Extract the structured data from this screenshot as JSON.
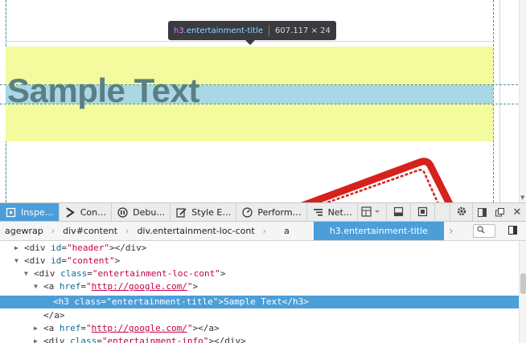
{
  "page": {
    "sample_text": "Sample Text"
  },
  "tooltip": {
    "tag": "h3",
    "class_name": ".entertainment-title",
    "dimensions": "607.117 × 24"
  },
  "toolbar": {
    "tabs": [
      {
        "label": "Inspe…",
        "icon": "inspector-icon",
        "active": true
      },
      {
        "label": "Con…",
        "icon": "console-icon",
        "active": false
      },
      {
        "label": "Debu…",
        "icon": "debugger-icon",
        "active": false
      },
      {
        "label": "Style E…",
        "icon": "style-editor-icon",
        "active": false
      },
      {
        "label": "Perform…",
        "icon": "performance-icon",
        "active": false
      },
      {
        "label": "Net…",
        "icon": "network-icon",
        "active": false
      }
    ]
  },
  "breadcrumbs": {
    "items": [
      "agewrap",
      "div#content",
      "div.entertainment-loc-cont",
      "a",
      "h3.entertainment-title"
    ],
    "active_index": 4
  },
  "markup": {
    "rows": [
      {
        "tag_open": "<div ",
        "attr": "id",
        "value": "\"header\"",
        "tag_close": "></div>"
      },
      {
        "tag_open": "<div ",
        "attr": "id",
        "value": "\"content\"",
        "tag_close": ">"
      },
      {
        "tag_open": "<div ",
        "attr": "class",
        "value": "\"entertainment-loc-cont\"",
        "tag_close": ">"
      },
      {
        "tag_open": "<a ",
        "attr": "href",
        "value": "\"",
        "link": "http://google.com/",
        "value_end": "\"",
        "tag_close": ">"
      },
      {
        "tag_open": "<h3 ",
        "attr": "class",
        "value": "\"entertainment-title\"",
        "tag_close": ">Sample Text</h3>"
      },
      {
        "text": "</a>"
      },
      {
        "tag_open": "<a ",
        "attr": "href",
        "value": "\"",
        "link": "http://google.com/",
        "value_end": "\"",
        "tag_close": "></a>"
      },
      {
        "tag_open": "<div ",
        "attr": "class",
        "value": "\"entertainment-info\"",
        "tag_close": "></div>"
      }
    ]
  },
  "colors": {
    "accent": "#4c9ed9",
    "margin_highlight": "#f4fb9f",
    "content_highlight": "#a9d7e5",
    "stamp_red": "#d6221b"
  }
}
